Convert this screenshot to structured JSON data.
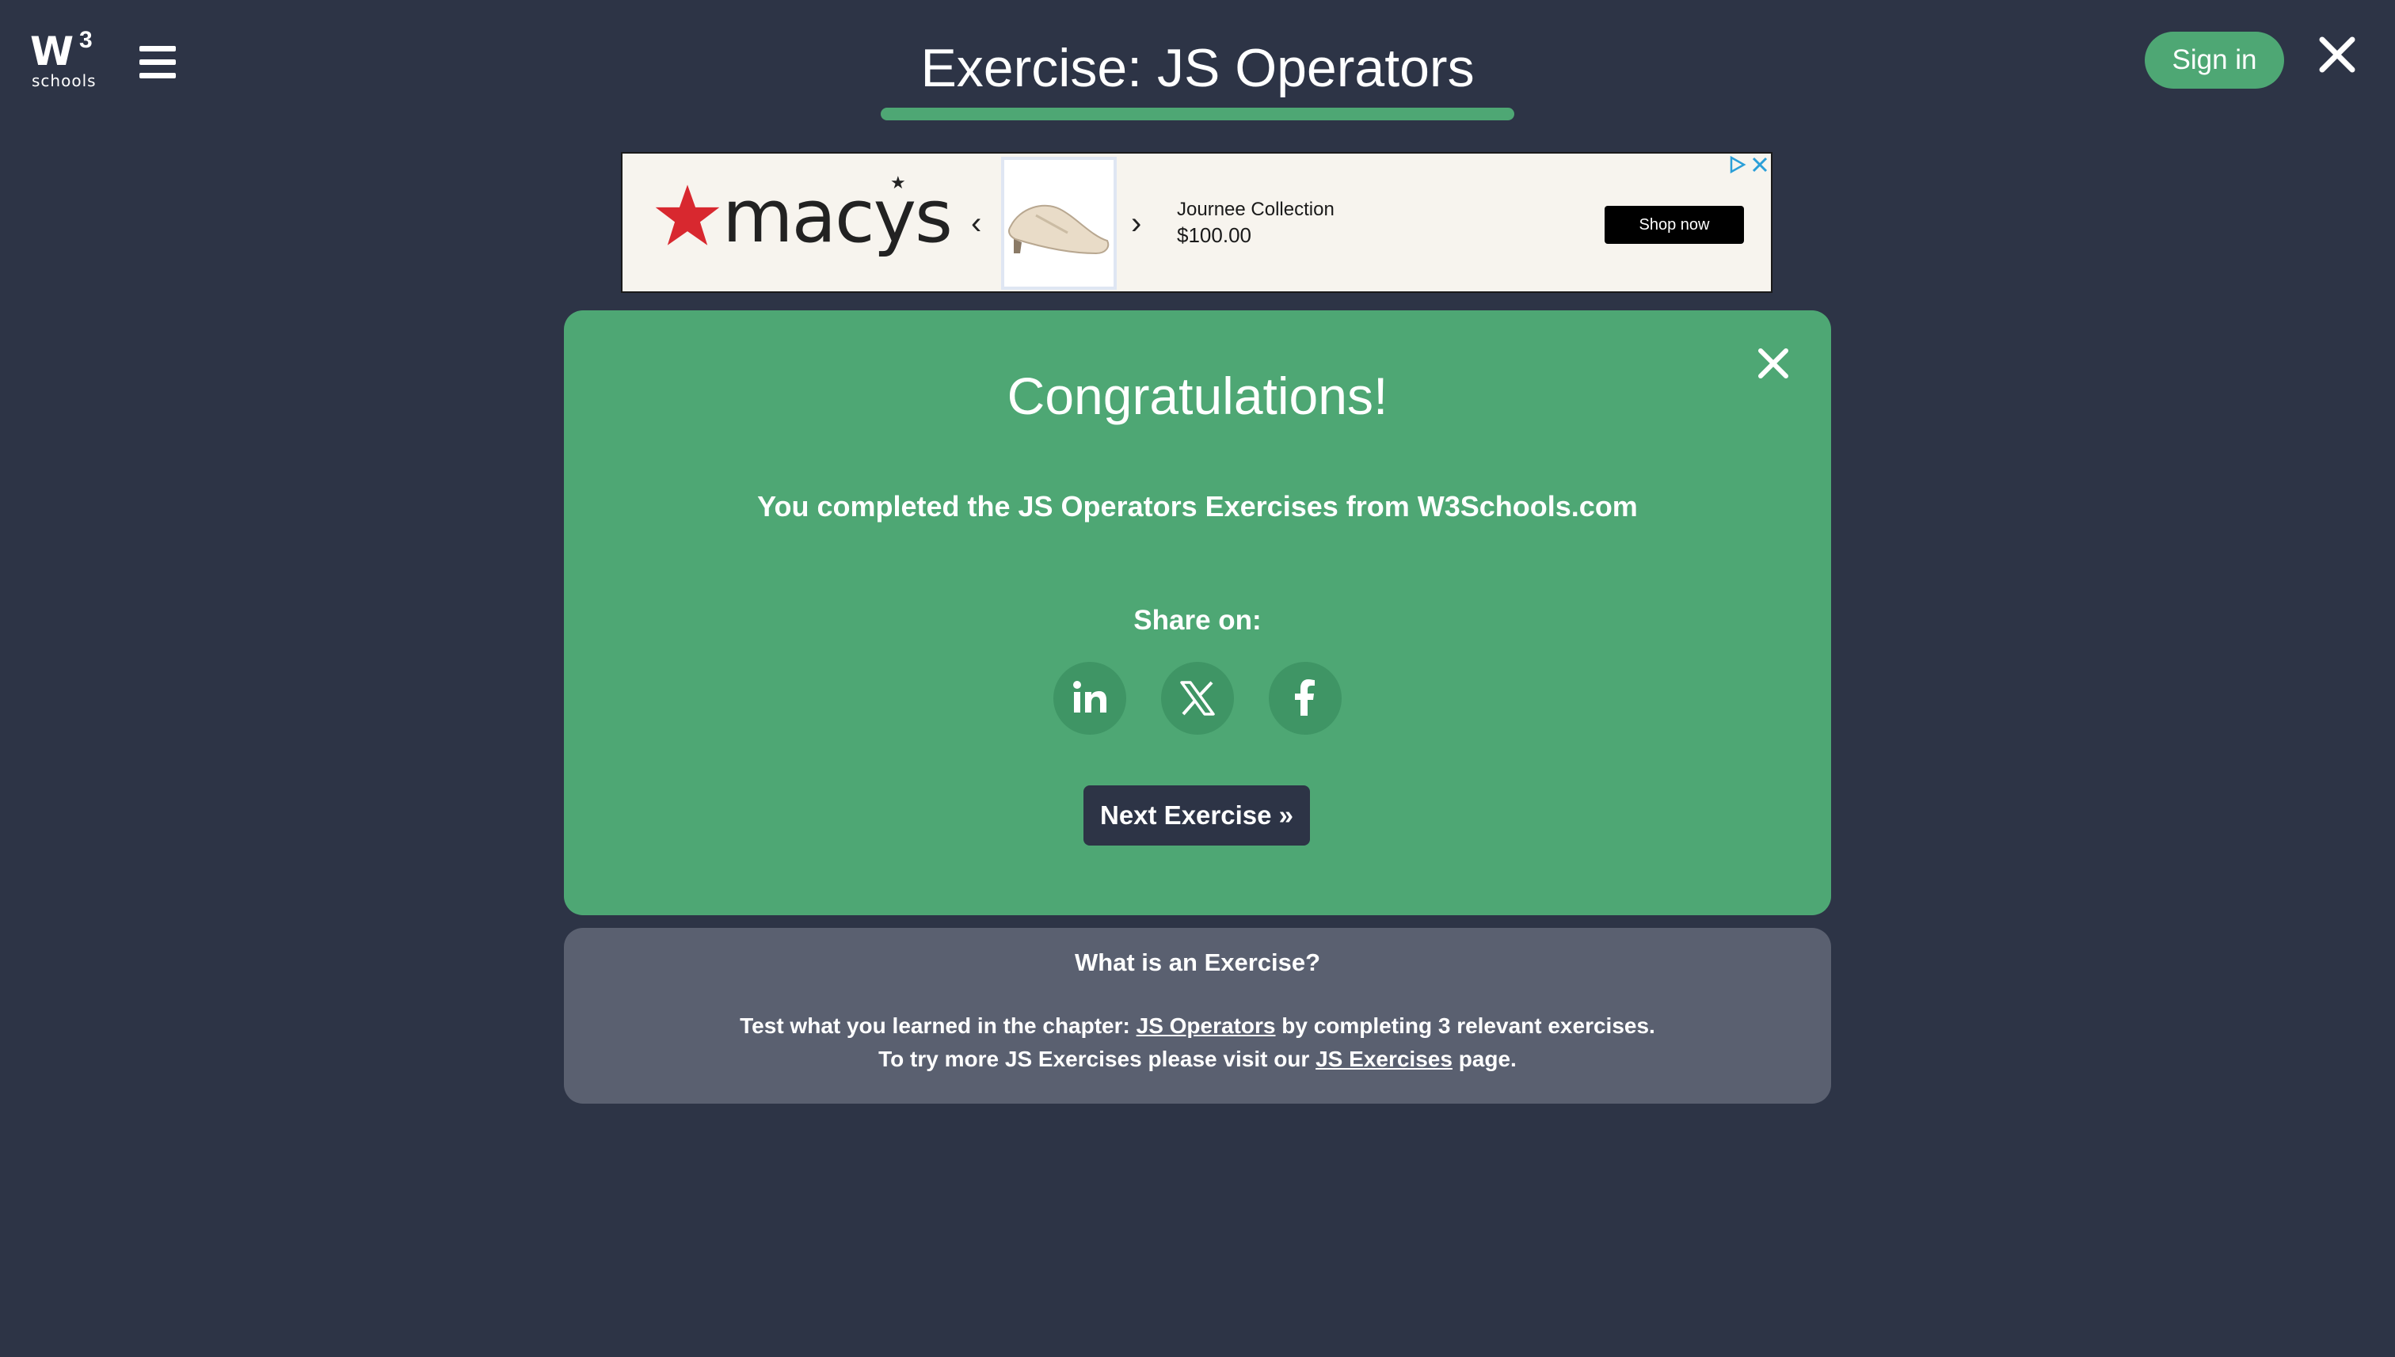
{
  "header": {
    "logo_text": "W",
    "logo_superscript": "3",
    "logo_subtext": "schools",
    "title": "Exercise: JS Operators",
    "signin_label": "Sign in"
  },
  "ad": {
    "brand": "macys",
    "brand_star": "★",
    "prev_glyph": "‹",
    "next_glyph": "›",
    "product_name": "Journee Collection",
    "price": "$100.00",
    "shop_label": "Shop now",
    "brand_color": "#d8282f"
  },
  "congrats": {
    "heading": "Congratulations!",
    "message": "You completed the JS Operators Exercises from W3Schools.com",
    "share_label": "Share on:",
    "share_icons": [
      "linkedin-icon",
      "x-icon",
      "facebook-icon"
    ],
    "next_label": "Next Exercise »"
  },
  "info": {
    "title": "What is an Exercise?",
    "line1_prefix": "Test what you learned in the chapter: ",
    "line1_link": "JS Operators",
    "line1_suffix": " by completing 3 relevant exercises.",
    "line2_prefix": "To try more JS Exercises please visit our ",
    "line2_link": "JS Exercises",
    "line2_suffix": " page."
  },
  "colors": {
    "background": "#2d3446",
    "accent_green": "#4ea774",
    "info_gray": "#5a6070"
  }
}
